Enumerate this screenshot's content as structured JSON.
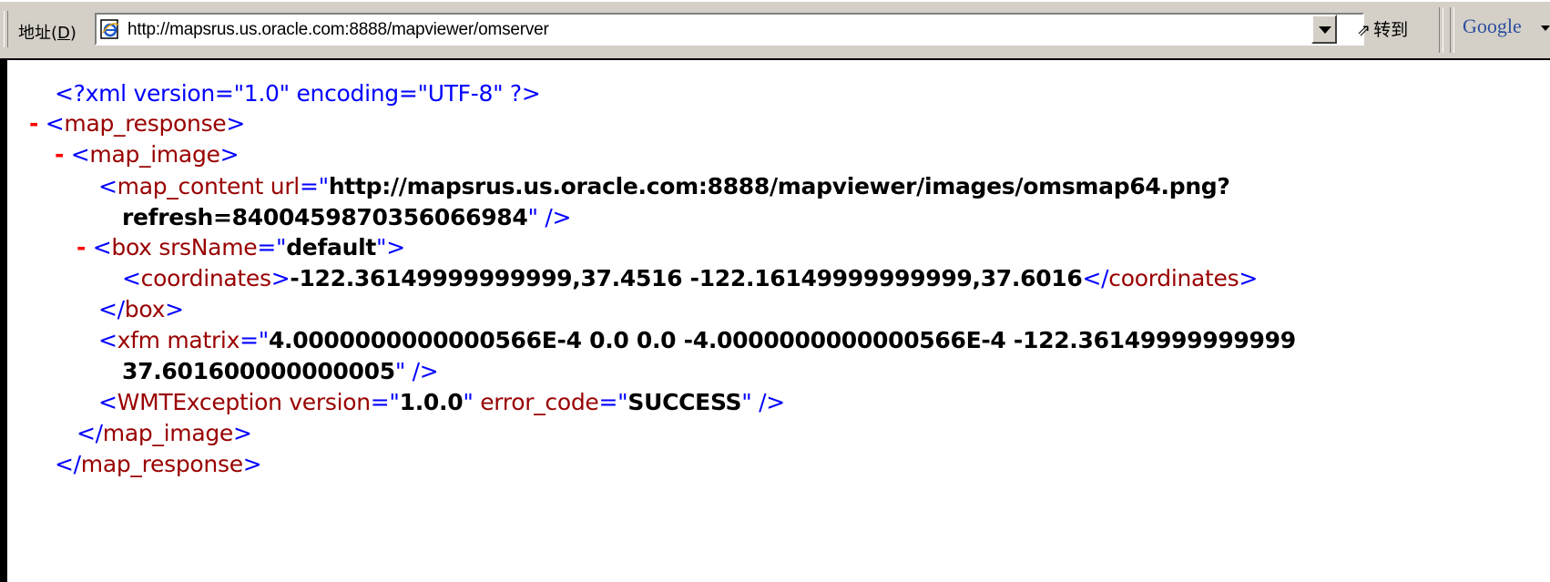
{
  "addressbar": {
    "label_text": "地址(",
    "label_key": "D",
    "label_end": ")",
    "url": "http://mapsrus.us.oracle.com:8888/mapviewer/omserver",
    "go_label": "转到",
    "search_brand": "Google"
  },
  "xml": {
    "decl": "<?xml version=\"1.0\" encoding=\"UTF-8\" ?>",
    "minus": "-",
    "map_response_open": "map_response",
    "map_image_open": "map_image",
    "map_content_tag": "map_content",
    "map_content_attr": "url",
    "map_content_url_1": "http://mapsrus.us.oracle.com:8888/mapviewer/images/omsmap64.png?",
    "map_content_url_2": "refresh=8400459870356066984",
    "box_tag": "box",
    "box_attr": "srsName",
    "box_value": "default",
    "coordinates_tag": "coordinates",
    "coordinates_value": "-122.36149999999999,37.4516 -122.16149999999999,37.6016",
    "box_close": "box",
    "xfm_tag": "xfm",
    "xfm_attr": "matrix",
    "xfm_value_1": "4.0000000000000566E-4 0.0 0.0 -4.0000000000000566E-4 -122.36149999999999",
    "xfm_value_2": "37.601600000000005",
    "wmt_tag": "WMTException",
    "wmt_attr1": "version",
    "wmt_val1": "1.0.0",
    "wmt_attr2": "error_code",
    "wmt_val2": "SUCCESS",
    "map_image_close": "map_image",
    "map_response_close": "map_response"
  },
  "colors": {
    "markup_blue": "#0000ff",
    "tag_red": "#990000",
    "collapse_red": "#ff0000",
    "chrome_gray": "#d4d0c8"
  }
}
